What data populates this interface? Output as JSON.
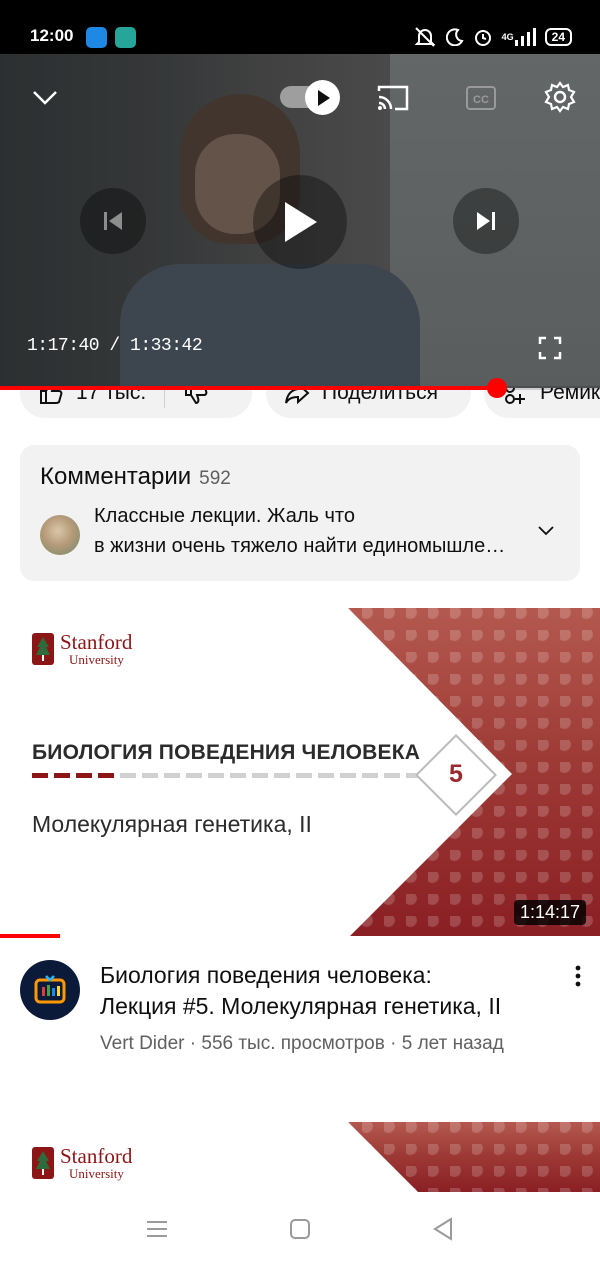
{
  "status_bar": {
    "time": "12:00",
    "network": "4G",
    "battery": "24",
    "icons": [
      "android-app-icon",
      "messenger-app-icon",
      "silent-bell-icon",
      "moon-icon",
      "alarm-icon",
      "signal-icon",
      "battery-icon"
    ]
  },
  "player": {
    "time_readout": "1:17:40 / 1:33:42",
    "progress_fraction": 0.829,
    "autoplay_on": true,
    "controls": [
      "chevron-down-icon",
      "autoplay-toggle",
      "cast-icon",
      "cc-icon",
      "settings-icon",
      "skip-previous-icon",
      "play-icon",
      "skip-next-icon",
      "fullscreen-icon"
    ],
    "accent_color": "#ff0000"
  },
  "actions": {
    "like_label": "17 тыс.",
    "share_label": "Поделиться",
    "remix_label": "Ремикс"
  },
  "comments": {
    "title": "Комментарии",
    "count": "592",
    "preview_line1": "Классные лекции. Жаль что",
    "preview_line2": "в жизни очень тяжело найти единомышленников"
  },
  "next_video": {
    "thumbnail": {
      "brand": "Stanford",
      "brand_sub": "University",
      "series_title": "БИОЛОГИЯ ПОВЕДЕНИЯ ЧЕЛОВЕКА",
      "lecture_number": "5",
      "lecture_subtitle": "Молекулярная генетика, II",
      "duration": "1:14:17",
      "accent_color": "#8c1515"
    },
    "title_line1": "Биология поведения человека:",
    "title_line2": "Лекция #5. Молекулярная генетика, II",
    "channel": "Vert Dider",
    "views": "556 тыс. просмотров",
    "age": "5 лет назад",
    "separator": "·"
  },
  "second_video": {
    "thumbnail": {
      "brand": "Stanford",
      "brand_sub": "University"
    }
  },
  "nav_bar": {
    "icons": [
      "menu-icon",
      "home-icon",
      "back-icon"
    ]
  }
}
